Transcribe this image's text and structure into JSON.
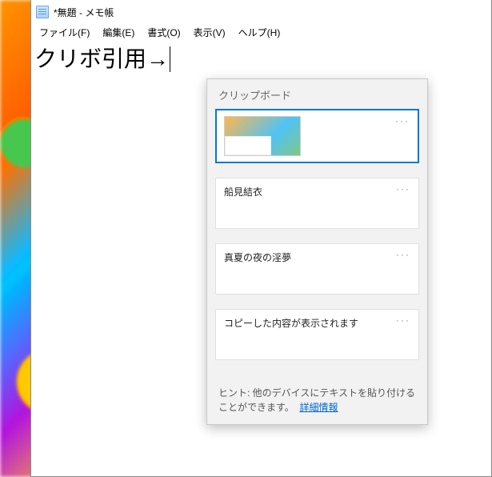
{
  "window": {
    "title": "*無題 - メモ帳"
  },
  "menu": {
    "file": "ファイル(F)",
    "edit": "編集(E)",
    "format": "書式(O)",
    "view": "表示(V)",
    "help": "ヘルプ(H)"
  },
  "editor": {
    "content": "クリボ引用→"
  },
  "clipboard": {
    "title": "クリップボード",
    "items": [
      {
        "type": "image"
      },
      {
        "type": "text",
        "text": "船見結衣"
      },
      {
        "type": "text",
        "text": "真夏の夜の淫夢"
      },
      {
        "type": "text",
        "text": "コピーした内容が表示されます"
      }
    ],
    "more_glyph": "···",
    "hint_prefix": "ヒント: 他のデバイスにテキストを貼り付けることができます。",
    "hint_link": "詳細情報"
  }
}
